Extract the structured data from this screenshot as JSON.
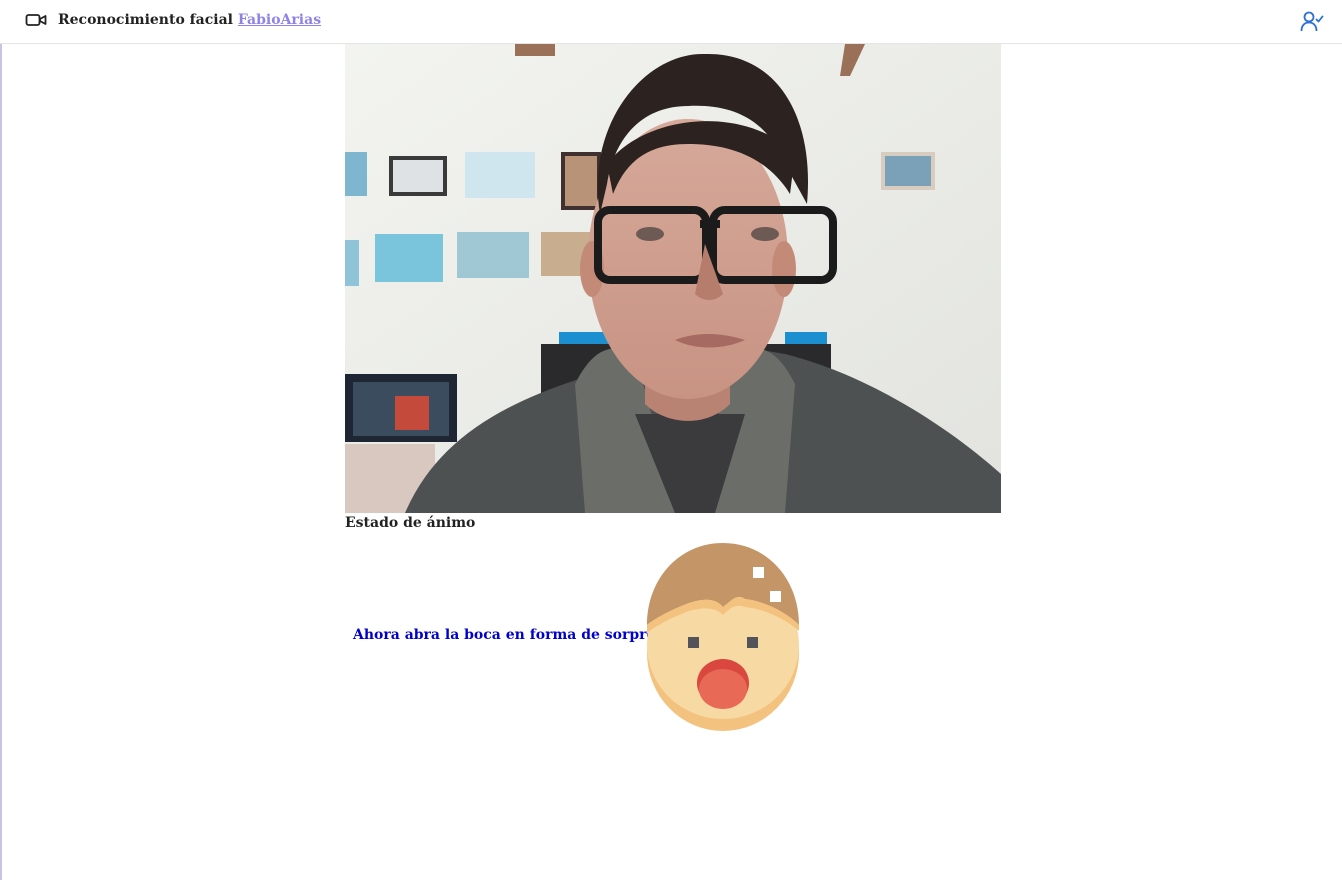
{
  "header": {
    "title": "Reconocimiento facial",
    "user_link": "FabioArias",
    "camera_icon": "video-camera-icon",
    "user_icon": "user-check-icon"
  },
  "main": {
    "video_feed": "webcam-feed",
    "mood_label": "Estado de ánimo",
    "instruction": "Ahora abra la boca en forma de sorprensa",
    "emotion_icon": "surprised-face-icon"
  },
  "colors": {
    "link": "#8f84e6",
    "instruction": "#0000cc",
    "accent_icon": "#2e6fd6"
  }
}
